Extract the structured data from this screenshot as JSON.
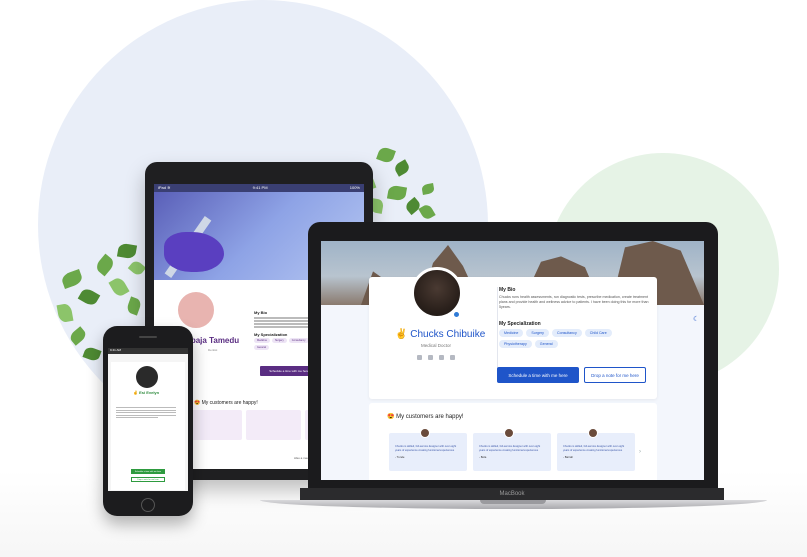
{
  "scene": {
    "accent_blue": "#1f55c9",
    "tablet_accent": "#5a2d82",
    "phone_accent": "#2e9b3f"
  },
  "laptop": {
    "brand": "MacBook",
    "profile": {
      "name": "✌ Chucks Chibuike",
      "role": "Medical Doctor",
      "bio_heading": "My Bio",
      "bio_text": "Chucks runs health assessments, run diagnostic tests, prescribe medication, create treatment plans and provide health and wellness advice to patients. I have been doing this for more than 5years.",
      "spec_heading": "My Specialization",
      "specializations": [
        "Medicine",
        "Surgery",
        "Consultancy",
        "Child Care",
        "Physiotherapy",
        "General"
      ],
      "primary_button": "Schedule a time with me here",
      "secondary_button": "Drop a note for me here",
      "theme_icon": "moon-icon"
    },
    "reviews": {
      "heading": "😍 My customers are happy!",
      "items": [
        {
          "text": "Chucks is skilled, full-service designer with over eight years of experience creating functional experiences",
          "author": "- Tunde"
        },
        {
          "text": "Chucks is skilled, full-service designer with over eight years of experience creating functional experiences",
          "author": "- Bola"
        },
        {
          "text": "Chucks is skilled, full-service designer with over eight years of experience creating functional experiences",
          "author": "- Barrah"
        }
      ],
      "next_icon": "chevron-right-icon"
    }
  },
  "tablet": {
    "status_carrier": "iPad ≋",
    "status_time": "9:41 PM",
    "status_battery": "100%",
    "name": "✌ Logbaja Tamedu",
    "role": "Dentist",
    "bio_heading": "My Bio",
    "spec_heading": "My Specialization",
    "specializations": [
      "Medicine",
      "Surgery",
      "Consultancy",
      "Child Care",
      "Physiotherapy",
      "General"
    ],
    "button": "Schedule a time with me here",
    "happy": "😍 My customers are happy!",
    "more": "Also a medical doctor"
  },
  "phone": {
    "status_time": "9:41 AM",
    "name": "✌ Esi Evelyn",
    "button_primary": "Schedule a time with me here",
    "button_secondary": "Drop a note for me here"
  }
}
